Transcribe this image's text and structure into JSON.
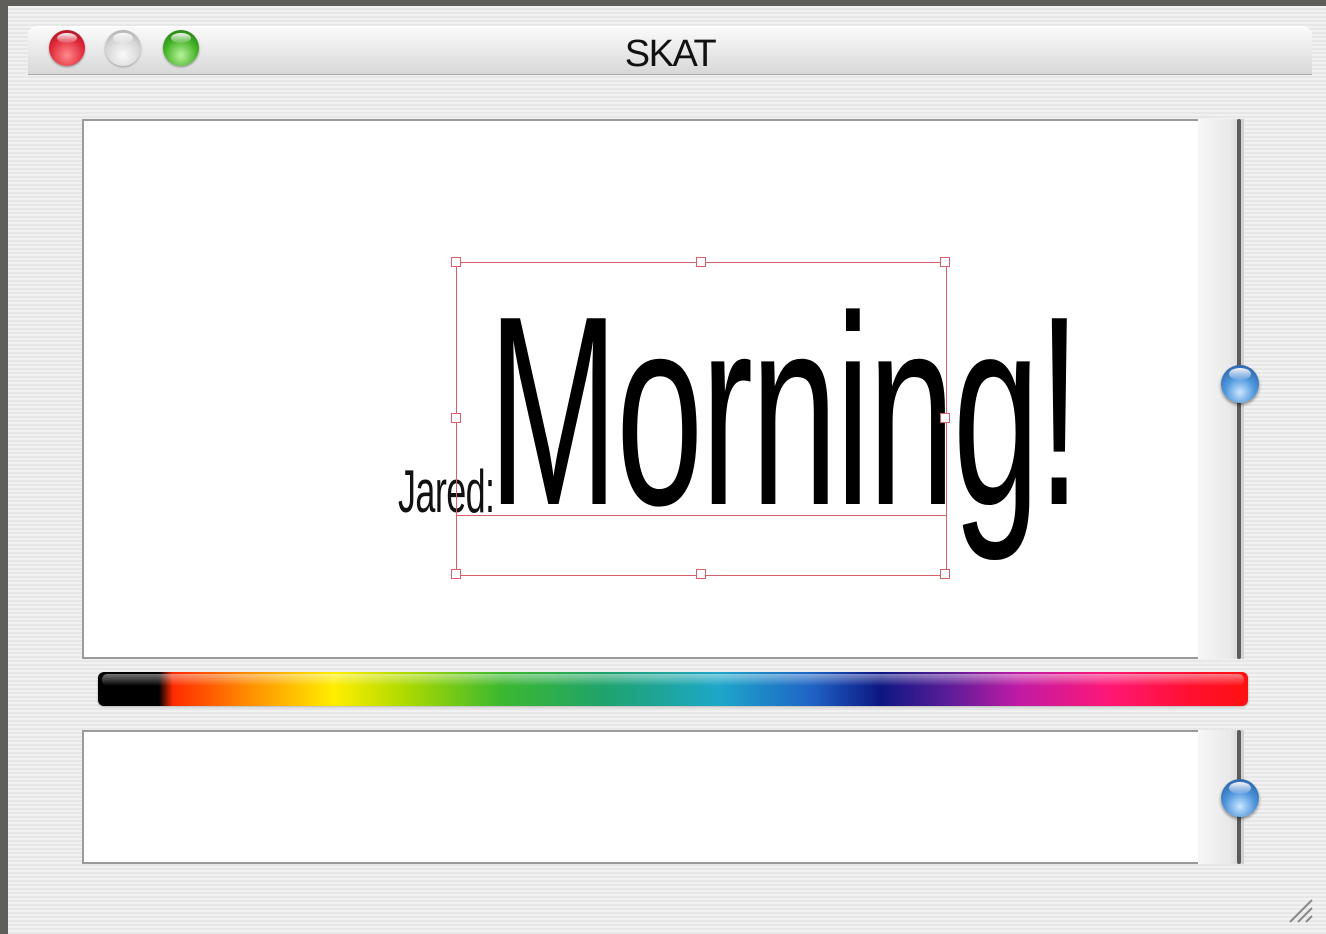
{
  "window": {
    "title": "SKAT"
  },
  "traffic_lights": [
    {
      "name": "close",
      "color": "#e0283a"
    },
    {
      "name": "minimize",
      "color": "#d6d6d6"
    },
    {
      "name": "zoom",
      "color": "#3fae23"
    }
  ],
  "canvas": {
    "speaker": "Jared:",
    "message": "Morning!"
  },
  "colors": {
    "selection": "#d8606a",
    "slider_knob": "#4f95dc",
    "selected_color": "#000000"
  },
  "icons": [
    "resize-grip-icon",
    "slider-knob"
  ]
}
